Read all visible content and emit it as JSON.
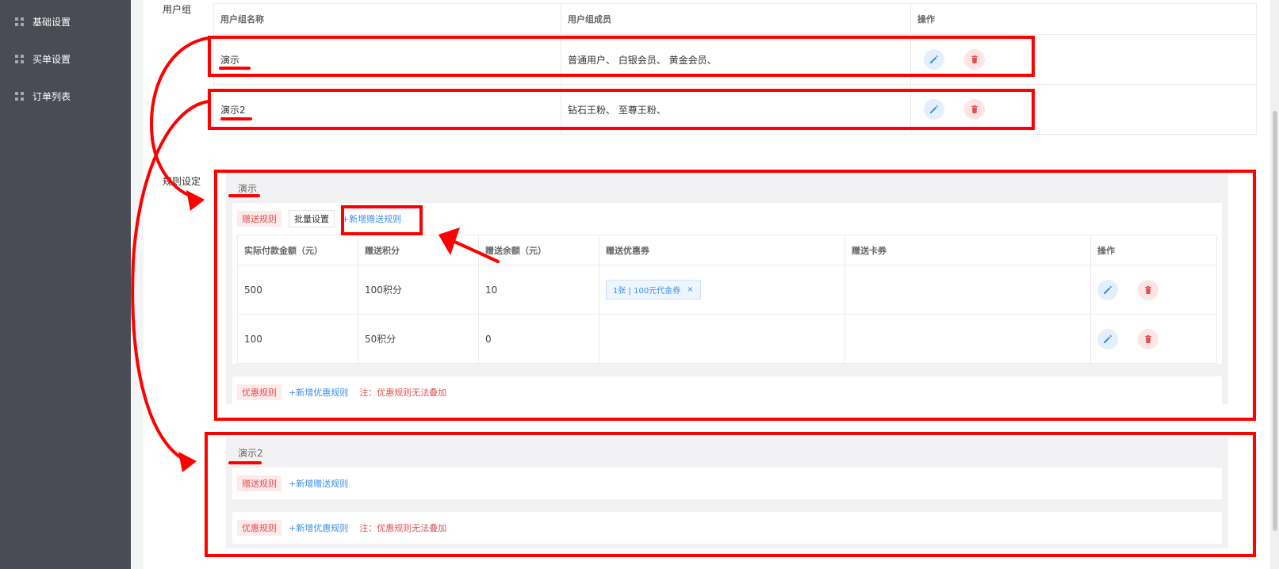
{
  "sidebar": {
    "items": [
      {
        "label": "基础设置"
      },
      {
        "label": "买单设置"
      },
      {
        "label": "订单列表"
      }
    ]
  },
  "user_group": {
    "section_label": "用户组",
    "headers": [
      "用户组名称",
      "用户组成员",
      "操作"
    ],
    "rows": [
      {
        "name": "演示",
        "members": "普通用户、 白银会员、 黄金会员、"
      },
      {
        "name": "演示2",
        "members": "钻石王粉、 至尊王粉、"
      }
    ]
  },
  "rules": {
    "section_label": "规则设定",
    "blocks": [
      {
        "title": "演示",
        "gift_tag": "赠送规则",
        "batch_button": "批量设置",
        "add_gift_link": "+新增赠送规则",
        "headers": [
          "实际付款金额（元）",
          "赠送积分",
          "赠送余额（元）",
          "赠送优惠券",
          "赠送卡券",
          "操作"
        ],
        "rows": [
          {
            "amount": "500",
            "points": "100积分",
            "balance": "10",
            "coupon": "1张 | 100元代金券",
            "card": ""
          },
          {
            "amount": "100",
            "points": "50积分",
            "balance": "0",
            "coupon": "",
            "card": ""
          }
        ],
        "discount_tag": "优惠规则",
        "add_discount_link": "+新增优惠规则",
        "note": "注：优惠规则无法叠加"
      },
      {
        "title": "演示2",
        "gift_tag": "赠送规则",
        "add_gift_link": "+新增赠送规则",
        "discount_tag": "优惠规则",
        "add_discount_link": "+新增优惠规则",
        "note": "注：优惠规则无法叠加"
      }
    ]
  },
  "icons": {
    "sidebar": "grid-icon",
    "edit": "pencil-icon",
    "delete": "trash-icon",
    "remove": "close-icon"
  },
  "colors": {
    "sidebar_bg": "#494c54",
    "annotation": "#ff0000",
    "link": "#3d8fe8",
    "danger": "#e25050"
  }
}
